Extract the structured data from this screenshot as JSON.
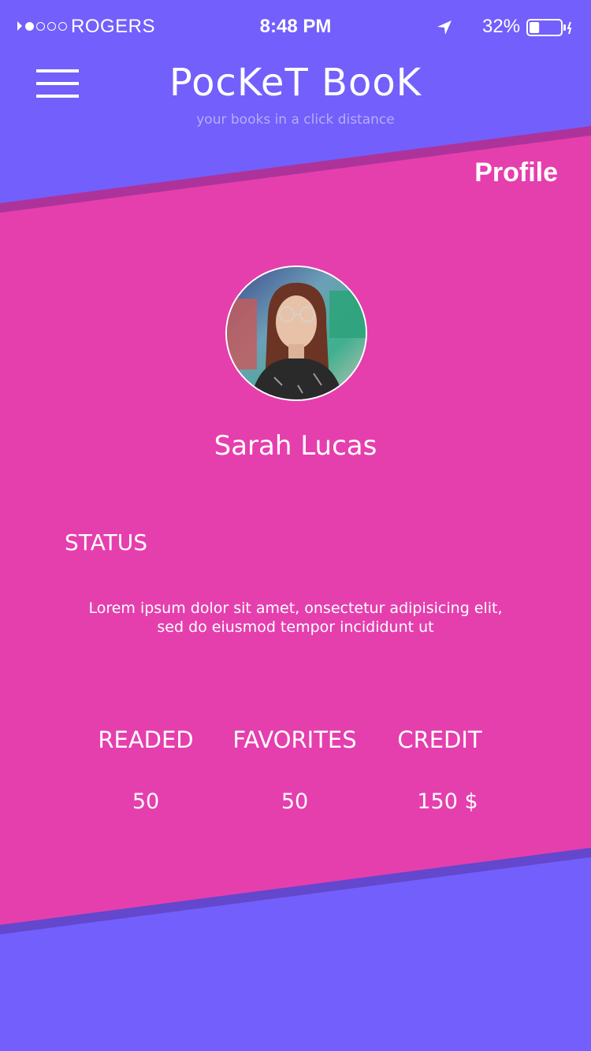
{
  "status_bar": {
    "carrier": "ROGERS",
    "time": "8:48 PM",
    "battery_percent": "32%",
    "battery_level": 0.32,
    "signal_bars_filled": 1,
    "signal_bars_total": 5,
    "icons": [
      "signal-icon",
      "location-arrow-icon",
      "battery-icon"
    ]
  },
  "header": {
    "logo": "PocKeT BooK",
    "tagline": "your books in a click distance",
    "menu_icon": "hamburger-menu-icon"
  },
  "profile": {
    "page_title": "Profile",
    "name": "Sarah Lucas",
    "status_label": "STATUS",
    "status_text": "Lorem ipsum dolor sit amet, onsectetur adipisicing elit,\nsed do eiusmod tempor incididunt ut"
  },
  "stats": [
    {
      "label": "READED",
      "value": "50"
    },
    {
      "label": "FAVORITES",
      "value": "50"
    },
    {
      "label": "CREDIT",
      "value": "150 $"
    }
  ],
  "colors": {
    "primary_purple": "#735ffb",
    "accent_pink": "#e53fae",
    "text_white": "#ffffff",
    "tagline": "#b7acf9"
  }
}
